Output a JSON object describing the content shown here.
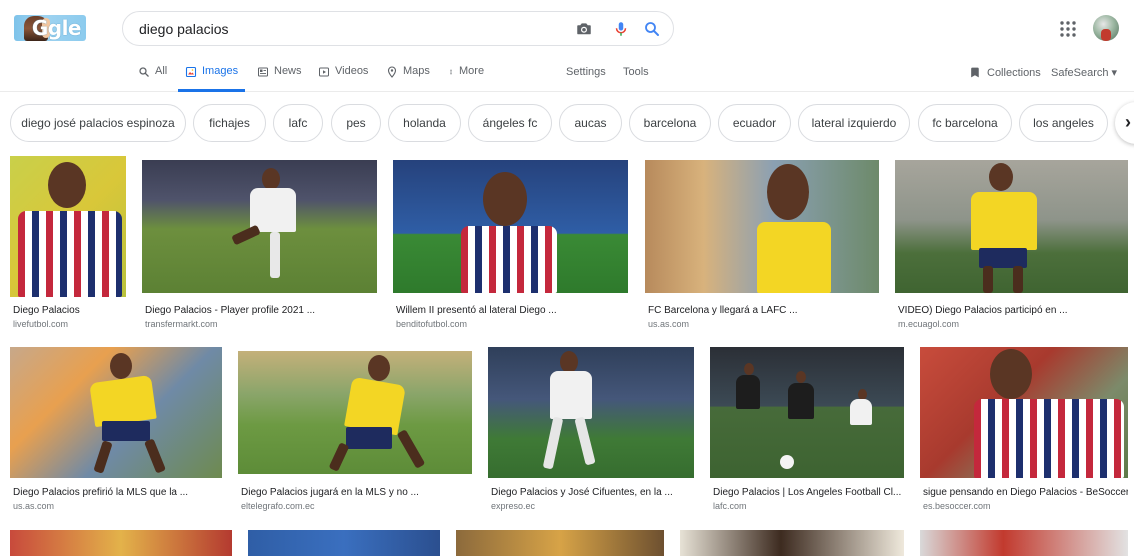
{
  "header": {
    "logo_text": "Ggle",
    "search_query": "diego palacios",
    "camera_icon": "camera-icon",
    "mic_icon": "mic-icon",
    "search_icon": "search-icon",
    "apps_icon": "apps-grid-icon",
    "avatar_icon": "account-avatar"
  },
  "nav": {
    "tabs": [
      {
        "label": "All",
        "icon": "search-icon",
        "active": false
      },
      {
        "label": "Images",
        "icon": "image-icon",
        "active": true
      },
      {
        "label": "News",
        "icon": "news-icon",
        "active": false
      },
      {
        "label": "Videos",
        "icon": "play-icon",
        "active": false
      },
      {
        "label": "Maps",
        "icon": "map-pin-icon",
        "active": false
      },
      {
        "label": "More",
        "icon": "dots-vertical-icon",
        "active": false
      }
    ],
    "settings": "Settings",
    "tools": "Tools",
    "collections": "Collections",
    "safesearch": "SafeSearch ▾",
    "accent_color": "#1a73e8"
  },
  "chips": [
    "diego josé palacios espinoza",
    "fichajes",
    "lafc",
    "pes",
    "holanda",
    "ángeles fc",
    "aucas",
    "barcelona",
    "ecuador",
    "lateral izquierdo",
    "fc barcelona",
    "los angeles"
  ],
  "results": {
    "row1": [
      {
        "title": "Diego Palacios",
        "source": "livefutbol.com"
      },
      {
        "title": "Diego Palacios - Player profile 2021 ...",
        "source": "transfermarkt.com"
      },
      {
        "title": "Willem II presentó al lateral Diego ...",
        "source": "benditofutbol.com"
      },
      {
        "title": "FC Barcelona y llegará a LAFC ...",
        "source": "us.as.com"
      },
      {
        "title": "VIDEO) Diego Palacios participó en ...",
        "source": "m.ecuagol.com"
      }
    ],
    "row2": [
      {
        "title": "Diego Palacios prefirió la MLS que la ...",
        "source": "us.as.com"
      },
      {
        "title": "Diego Palacios jugará en la MLS y no ...",
        "source": "eltelegrafo.com.ec"
      },
      {
        "title": "Diego Palacios y José Cifuentes, en la ...",
        "source": "expreso.ec"
      },
      {
        "title": "Diego Palacios | Los Angeles Football Cl...",
        "source": "lafc.com"
      },
      {
        "title": "sigue pensando en Diego Palacios - BeSoccer",
        "source": "es.besoccer.com"
      }
    ]
  }
}
